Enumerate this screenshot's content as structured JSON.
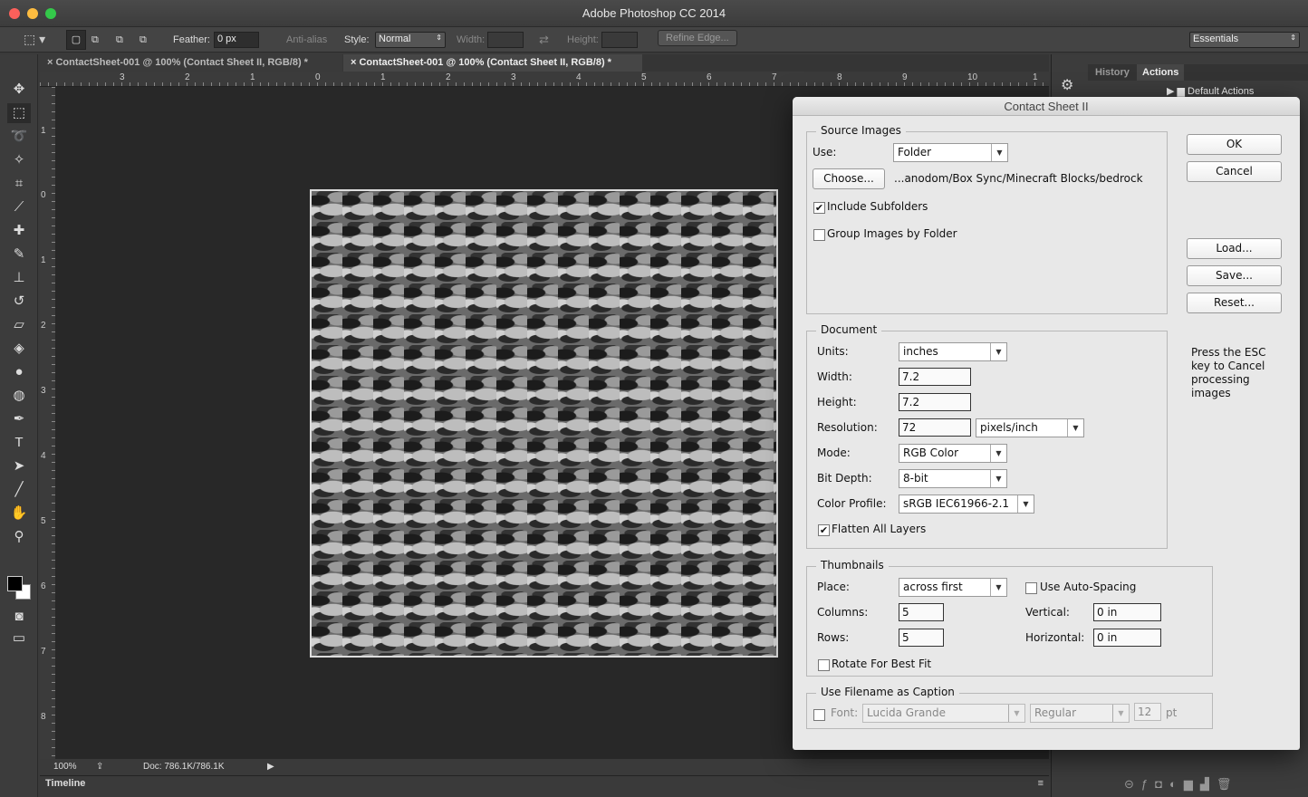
{
  "app": {
    "title": "Adobe Photoshop CC 2014",
    "colors": {
      "close": "#fc605b",
      "minimize": "#fdbc40",
      "zoom": "#34c84a"
    }
  },
  "options_bar": {
    "feather_label": "Feather:",
    "feather_value": "0 px",
    "anti_alias_label": "Anti-alias",
    "style_label": "Style:",
    "style_value": "Normal",
    "width_label": "Width:",
    "height_label": "Height:",
    "refine_edge": "Refine Edge...",
    "workspace": "Essentials"
  },
  "tabs": [
    {
      "label": "ContactSheet-001 @ 100% (Contact Sheet II, RGB/8) *",
      "active": false
    },
    {
      "label": "ContactSheet-001 @ 100% (Contact Sheet II, RGB/8) *",
      "active": true
    }
  ],
  "ruler_top": [
    "3",
    "2",
    "1",
    "0",
    "1",
    "2",
    "3",
    "4",
    "5",
    "6",
    "7",
    "8",
    "9",
    "10",
    "1"
  ],
  "ruler_left": [
    "1",
    "0",
    "1",
    "2",
    "3",
    "4",
    "5",
    "6",
    "7",
    "8"
  ],
  "tools": [
    {
      "name": "move-icon",
      "glyph": "✥"
    },
    {
      "name": "marquee-icon",
      "glyph": "⬚"
    },
    {
      "name": "lasso-icon",
      "glyph": "➰"
    },
    {
      "name": "magic-wand-icon",
      "glyph": "✧"
    },
    {
      "name": "crop-icon",
      "glyph": "⌗"
    },
    {
      "name": "eyedropper-icon",
      "glyph": "⟋"
    },
    {
      "name": "healing-brush-icon",
      "glyph": "✚"
    },
    {
      "name": "brush-icon",
      "glyph": "✎"
    },
    {
      "name": "stamp-icon",
      "glyph": "⊥"
    },
    {
      "name": "history-brush-icon",
      "glyph": "↺"
    },
    {
      "name": "eraser-icon",
      "glyph": "▱"
    },
    {
      "name": "paint-bucket-icon",
      "glyph": "◈"
    },
    {
      "name": "blur-icon",
      "glyph": "●"
    },
    {
      "name": "dodge-icon",
      "glyph": "◍"
    },
    {
      "name": "pen-icon",
      "glyph": "✒"
    },
    {
      "name": "type-icon",
      "glyph": "T"
    },
    {
      "name": "path-selection-icon",
      "glyph": "➤"
    },
    {
      "name": "line-icon",
      "glyph": "╱"
    },
    {
      "name": "hand-icon",
      "glyph": "✋"
    },
    {
      "name": "zoom-icon",
      "glyph": "⚲"
    }
  ],
  "status": {
    "zoom": "100%",
    "doc": "Doc: 786.1K/786.1K"
  },
  "timeline": {
    "label": "Timeline"
  },
  "panels": {
    "tabs": [
      "History",
      "Actions"
    ],
    "active": "Actions",
    "actions_item": "Default Actions"
  },
  "dialog": {
    "title": "Contact Sheet II",
    "source": {
      "legend": "Source Images",
      "use_label": "Use:",
      "use_value": "Folder",
      "choose": "Choose...",
      "path": "...anodom/Box Sync/Minecraft Blocks/bedrock",
      "include_subfolders": {
        "label": "Include Subfolders",
        "checked": true
      },
      "group_by_folder": {
        "label": "Group Images by Folder",
        "checked": false
      }
    },
    "document": {
      "legend": "Document",
      "units_label": "Units:",
      "units": "inches",
      "width_label": "Width:",
      "width": "7.2",
      "height_label": "Height:",
      "height": "7.2",
      "resolution_label": "Resolution:",
      "resolution": "72",
      "resolution_unit": "pixels/inch",
      "mode_label": "Mode:",
      "mode": "RGB Color",
      "bit_depth_label": "Bit Depth:",
      "bit_depth": "8-bit",
      "profile_label": "Color Profile:",
      "profile": "sRGB IEC61966-2.1",
      "flatten": {
        "label": "Flatten All Layers",
        "checked": true
      }
    },
    "thumbnails": {
      "legend": "Thumbnails",
      "place_label": "Place:",
      "place": "across first",
      "auto_spacing": {
        "label": "Use Auto-Spacing",
        "checked": false
      },
      "columns_label": "Columns:",
      "columns": "5",
      "rows_label": "Rows:",
      "rows": "5",
      "vertical_label": "Vertical:",
      "vertical": "0 in",
      "horizontal_label": "Horizontal:",
      "horizontal": "0 in",
      "rotate": {
        "label": "Rotate For Best Fit",
        "checked": false
      }
    },
    "caption": {
      "legend": "Use Filename as Caption",
      "font_label": "Font:",
      "font": "Lucida Grande",
      "style": "Regular",
      "size": "12",
      "unit": "pt",
      "checked": false
    },
    "buttons": {
      "ok": "OK",
      "cancel": "Cancel",
      "load": "Load...",
      "save": "Save...",
      "reset": "Reset..."
    },
    "hint": "Press the ESC key to Cancel processing images"
  }
}
